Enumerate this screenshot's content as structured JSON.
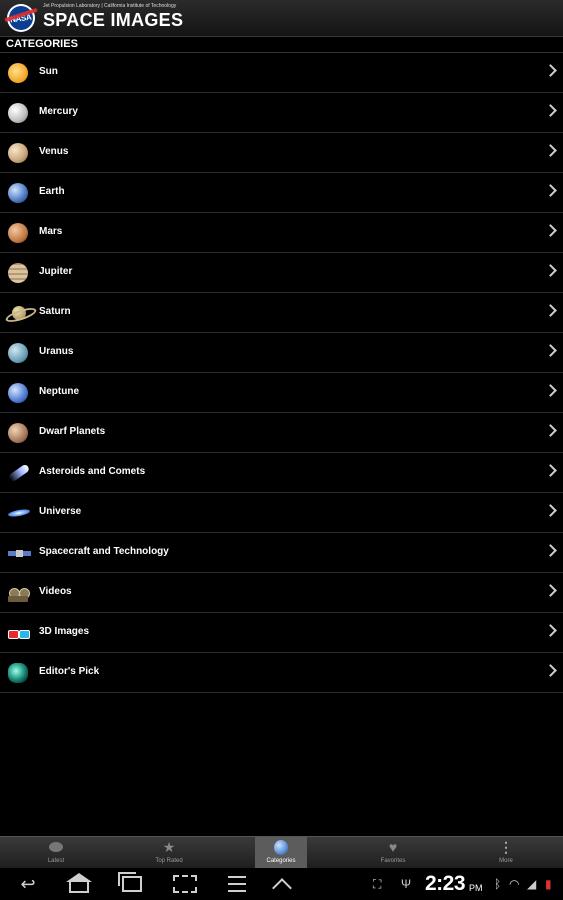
{
  "header": {
    "logo_text": "NASA",
    "jpl_line": "Jet Propulsion Laboratory | California Institute of Technology",
    "title": "SPACE IMAGES"
  },
  "section_label": "CATEGORIES",
  "categories": [
    {
      "label": "Sun",
      "icon": "sun-icon"
    },
    {
      "label": "Mercury",
      "icon": "mercury-icon"
    },
    {
      "label": "Venus",
      "icon": "venus-icon"
    },
    {
      "label": "Earth",
      "icon": "earth-icon"
    },
    {
      "label": "Mars",
      "icon": "mars-icon"
    },
    {
      "label": "Jupiter",
      "icon": "jupiter-icon"
    },
    {
      "label": "Saturn",
      "icon": "saturn-icon"
    },
    {
      "label": "Uranus",
      "icon": "uranus-icon"
    },
    {
      "label": "Neptune",
      "icon": "neptune-icon"
    },
    {
      "label": "Dwarf Planets",
      "icon": "dwarf-planet-icon"
    },
    {
      "label": "Asteroids and Comets",
      "icon": "comet-icon"
    },
    {
      "label": "Universe",
      "icon": "galaxy-icon"
    },
    {
      "label": "Spacecraft and Technology",
      "icon": "satellite-icon"
    },
    {
      "label": "Videos",
      "icon": "film-reel-icon"
    },
    {
      "label": "3D Images",
      "icon": "3d-glasses-icon"
    },
    {
      "label": "Editor's Pick",
      "icon": "nebula-icon"
    }
  ],
  "tabs": [
    {
      "label": "Latest",
      "icon": "planet-icon",
      "active": false
    },
    {
      "label": "Top Rated",
      "icon": "star-icon",
      "active": false
    },
    {
      "label": "Categories",
      "icon": "globe-icon",
      "active": true
    },
    {
      "label": "Favorites",
      "icon": "heart-icon",
      "active": false
    },
    {
      "label": "More",
      "icon": "more-dots-icon",
      "active": false
    }
  ],
  "system_bar": {
    "time": "2:23",
    "ampm": "PM"
  },
  "colors": {
    "background": "#000000",
    "tab_active": "#5c5c5c",
    "text": "#ffffff",
    "nasa_blue": "#0b3d91"
  }
}
